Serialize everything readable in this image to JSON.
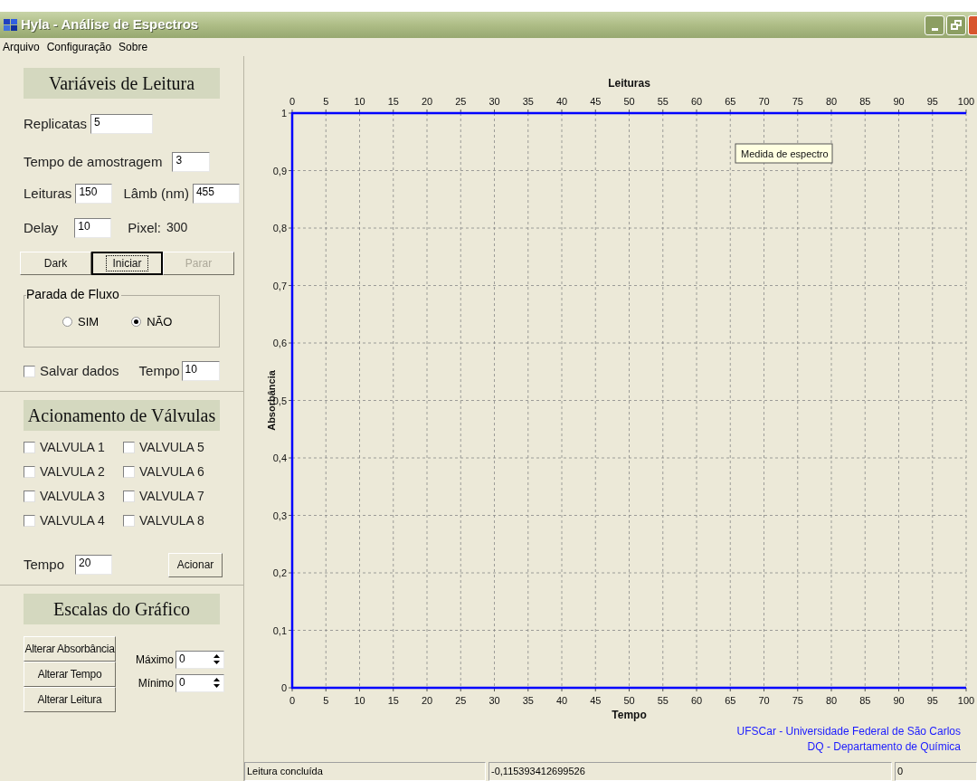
{
  "window": {
    "title": "Hyla - Análise de Espectros"
  },
  "menu": [
    "Arquivo",
    "Configuração",
    "Sobre"
  ],
  "reading": {
    "heading": "Variáveis de Leitura",
    "replicatas": {
      "label": "Replicatas",
      "value": "5"
    },
    "sampling_time": {
      "label": "Tempo de amostragem",
      "value": "3"
    },
    "readings": {
      "label": "Leituras",
      "value": "150"
    },
    "wavelength": {
      "label": "Lâmb (nm)",
      "value": "455"
    },
    "delay": {
      "label": "Delay",
      "value": "10"
    },
    "pixel": {
      "label": "Pixel:",
      "value": "300"
    },
    "buttons": [
      {
        "label": "Dark",
        "focused": false,
        "disabled": false
      },
      {
        "label": "Iniciar",
        "focused": true,
        "disabled": false
      },
      {
        "label": "Parar",
        "focused": false,
        "disabled": true
      }
    ],
    "flow_stop": {
      "legend": "Parada de Fluxo",
      "options": [
        {
          "label": "SIM",
          "selected": false
        },
        {
          "label": "NÃO",
          "selected": true
        }
      ]
    },
    "save": {
      "label": "Salvar dados",
      "checked": false
    },
    "save_time": {
      "label": "Tempo",
      "value": "10"
    }
  },
  "valves": {
    "heading": "Acionamento de Válvulas",
    "items": [
      {
        "label": "VALVULA 1",
        "checked": false
      },
      {
        "label": "VALVULA 2",
        "checked": false
      },
      {
        "label": "VALVULA 3",
        "checked": false
      },
      {
        "label": "VALVULA 4",
        "checked": false
      },
      {
        "label": "VALVULA 5",
        "checked": false
      },
      {
        "label": "VALVULA 6",
        "checked": false
      },
      {
        "label": "VALVULA 7",
        "checked": false
      },
      {
        "label": "VALVULA 8",
        "checked": false
      }
    ],
    "time": {
      "label": "Tempo",
      "value": "20"
    },
    "button": "Acionar"
  },
  "scales": {
    "heading": "Escalas do Gráfico",
    "buttons": [
      "Alterar Absorbância",
      "Alterar Tempo",
      "Alterar Leitura"
    ],
    "spinners": [
      {
        "label": "Máximo",
        "value": "0"
      },
      {
        "label": "Mínimo",
        "value": "0"
      }
    ]
  },
  "chart": {
    "tooltip": "Medida de espectro",
    "top_axis": {
      "title": "Leituras",
      "ticks": [
        "0",
        "5",
        "10",
        "15",
        "20",
        "25",
        "30",
        "35",
        "40",
        "45",
        "50",
        "55",
        "60",
        "65",
        "70",
        "75",
        "80",
        "85",
        "90",
        "95",
        "100"
      ]
    },
    "chart_data": {
      "type": "line",
      "xlabel": "Tempo",
      "ylabel": "Absorbância",
      "grid": true,
      "xlim": [
        0,
        100
      ],
      "ylim": [
        0,
        1
      ],
      "xticks": [
        {
          "value": 0,
          "label": "0"
        },
        {
          "value": 5,
          "label": "5"
        },
        {
          "value": 10,
          "label": "10"
        },
        {
          "value": 15,
          "label": "15"
        },
        {
          "value": 20,
          "label": "20"
        },
        {
          "value": 25,
          "label": "25"
        },
        {
          "value": 30,
          "label": "30"
        },
        {
          "value": 35,
          "label": "35"
        },
        {
          "value": 40,
          "label": "40"
        },
        {
          "value": 45,
          "label": "45"
        },
        {
          "value": 50,
          "label": "50"
        },
        {
          "value": 55,
          "label": "55"
        },
        {
          "value": 60,
          "label": "60"
        },
        {
          "value": 65,
          "label": "65"
        },
        {
          "value": 70,
          "label": "70"
        },
        {
          "value": 75,
          "label": "75"
        },
        {
          "value": 80,
          "label": "80"
        },
        {
          "value": 85,
          "label": "85"
        },
        {
          "value": 90,
          "label": "90"
        },
        {
          "value": 95,
          "label": "95"
        },
        {
          "value": 100,
          "label": "100"
        }
      ],
      "yticks": [
        {
          "value": 0,
          "label": "0"
        },
        {
          "value": 0.1,
          "label": "0,1"
        },
        {
          "value": 0.2,
          "label": "0,2"
        },
        {
          "value": 0.3,
          "label": "0,3"
        },
        {
          "value": 0.4,
          "label": "0,4"
        },
        {
          "value": 0.5,
          "label": "0,5"
        },
        {
          "value": 0.6,
          "label": "0,6"
        },
        {
          "value": 0.7,
          "label": "0,7"
        },
        {
          "value": 0.8,
          "label": "0,8"
        },
        {
          "value": 0.9,
          "label": "0,9"
        },
        {
          "value": 1,
          "label": "1"
        }
      ]
    },
    "credits": [
      "UFSCar - Universidade Federal de São Carlos",
      "DQ - Departamento de Química"
    ]
  },
  "status_bar": [
    "Leitura concluída",
    "-0,115393412699526",
    "0"
  ]
}
